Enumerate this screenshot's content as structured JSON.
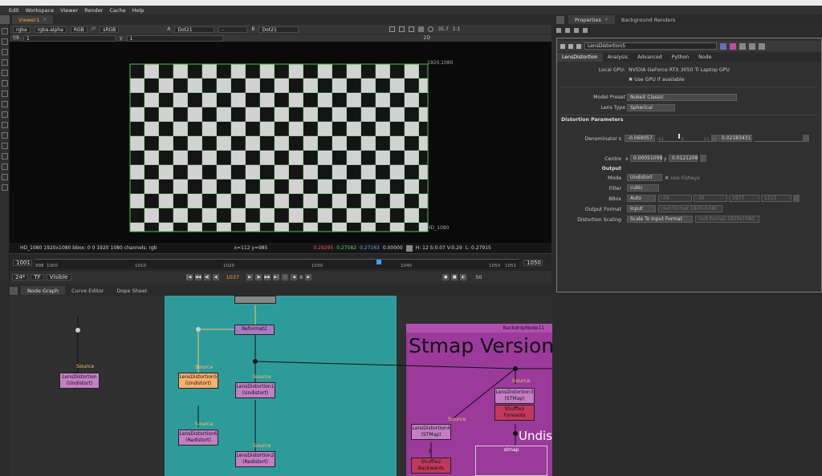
{
  "menu": [
    "Edit",
    "Workspace",
    "Viewer",
    "Render",
    "Cache",
    "Help"
  ],
  "viewer_tab": {
    "label": "Viewer1",
    "close": "×"
  },
  "prop_tabs": {
    "properties": "Properties",
    "bg": "Background Renders",
    "close": "×"
  },
  "viewer_toolbar": {
    "channels": "rgba",
    "alpha": "rgba.alpha",
    "colorspace": "RGB",
    "ip": "IP",
    "display": "sRGB",
    "a_label": "A",
    "a_value": "Dot21",
    "dash": "-",
    "b_label": "B",
    "b_value": "Dot21",
    "zoom": "35.7",
    "ratio": "1:1",
    "mode": "2D"
  },
  "viewer_toolbar2": {
    "fstop": "f/8",
    "frame": "1",
    "y_label": "y",
    "y_value": "1"
  },
  "viewer": {
    "format_top": "1920,1080",
    "format_bottom": "HD_1080"
  },
  "info": {
    "left": "HD_1080 1920x1080  bbox: 0 0 1920 1080  channels: rgb",
    "coords": "x=112 y=985",
    "r": "0.29295",
    "g": "0.27582",
    "b": "0.27163",
    "a": "0.00000",
    "hsv": "H: 12 S:0.07 V:0.29",
    "l": "L: 0.27915"
  },
  "timeline": {
    "start": "1001",
    "end": "1050",
    "ticks": [
      "998",
      "1000",
      "1010",
      "1020",
      "1030",
      "1040",
      "1050",
      "1052"
    ]
  },
  "playback": {
    "fps": "24*",
    "tf": "TF",
    "visible": "Visible",
    "frame": "1037",
    "step": "8",
    "end": "50"
  },
  "ng_tabs": [
    {
      "label": "Node Graph"
    },
    {
      "label": "Curve Editor"
    },
    {
      "label": "Dope Sheet"
    }
  ],
  "nodes": {
    "src": "Source",
    "ld_undistort": "LensDistortion\n(Undistort)",
    "reformat": "Reformat2",
    "ld5": "LensDistortion5\n(Undistort)",
    "ld1": "LensDistortion1\n(Undistort)",
    "ld6": "LensDistortion6\n(Redistort)",
    "ld2": "LensDistortion2\n(Redistort)",
    "ld4": "LensDistortion4\n(STMap)",
    "ld3": "LensDistortion3\n(STMap)",
    "shuffle1": "Shuffle1\nForwards",
    "shuffle2": "Shuffle2\nBackwards",
    "stmap": "stmap",
    "backdrop_name": "BackdropNode11",
    "backdrop_title": "Stmap Version",
    "undis": "Undis",
    "b_tag": "B"
  },
  "props": {
    "node_name": "LensDistortion5",
    "tabs": [
      "LensDistortion",
      "Analysis",
      "Advanced",
      "Python",
      "Node"
    ],
    "local_gpu_label": "Local GPU:",
    "local_gpu": "NVIDIA GeForce RTX 3050 Ti Laptop GPU",
    "use_gpu": "Use GPU if available",
    "model_preset_label": "Model Preset",
    "model_preset": "NukeX Classic",
    "lens_type_label": "Lens Type",
    "lens_type": "Spherical",
    "section": "Distortion Parameters",
    "denom_label": "Denominator s",
    "denom1": "-0.069057",
    "denom2": "0.02183431",
    "ticks1": [
      "-0.1",
      "0",
      "0.1"
    ],
    "centre_label": "Centre",
    "centre_x_label": "x",
    "centre_x": "0.00051098",
    "centre_y_label": "y",
    "centre_y": "0.0121208",
    "output_label": "Output",
    "mode_label": "Mode",
    "mode": "Undistort",
    "use_fisheye": "Use Fisheye",
    "filter_label": "Filter",
    "filter": "cubic",
    "bbox_label": "BBox",
    "bbox": "Auto",
    "bbox_x": "-58",
    "bbox_y": "-35",
    "bbox_r": "1977",
    "bbox_t": "1113",
    "outfmt_label": "Output Format",
    "outfmt": "Input",
    "outfmt_dim": "root.format 1920x1080",
    "scaling_label": "Distortion Scaling",
    "scaling": "Scale To Input Format",
    "scaling_dim": "root.format 1920x1080"
  }
}
